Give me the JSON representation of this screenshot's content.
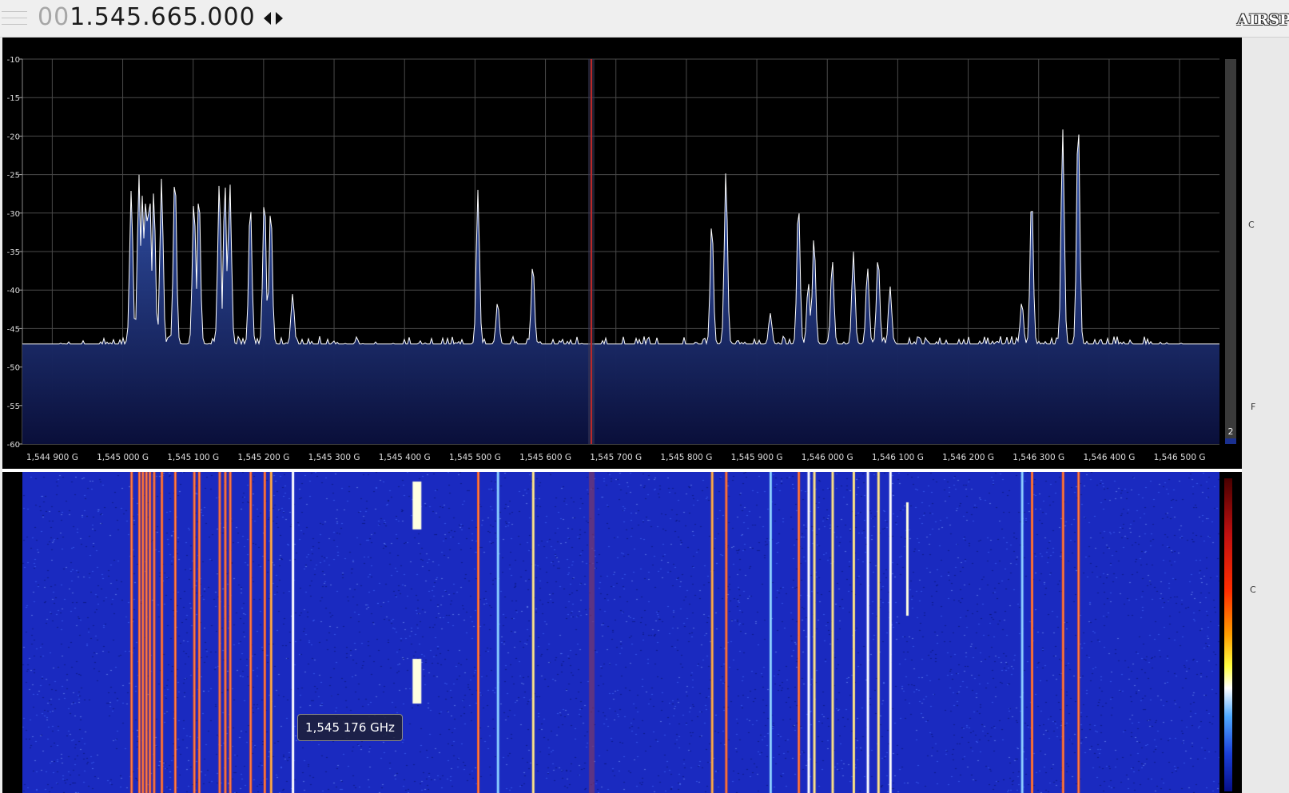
{
  "header": {
    "frequency_lead": "00",
    "frequency_main": "1.545.665.000",
    "logo": "AIRSPY"
  },
  "spectrum": {
    "db_labels": [
      "-10",
      "-15",
      "-20",
      "-25",
      "-30",
      "-35",
      "-40",
      "-45",
      "-50",
      "-55",
      "-60"
    ],
    "freq_labels": [
      "1,544 900 G",
      "1,545 000 G",
      "1,545 100 G",
      "1,545 200 G",
      "1,545 300 G",
      "1,545 400 G",
      "1,545 500 G",
      "1,545 600 G",
      "1,545 700 G",
      "1,545 800 G",
      "1,545 900 G",
      "1,546 000 G",
      "1,546 100 G",
      "1,546 200 G",
      "1,546 300 G",
      "1,546 400 G",
      "1,546 500 G"
    ],
    "level_indicator": "2",
    "noise_floor_db": -47,
    "peaks": [
      {
        "f": 1545.0121,
        "db": -27
      },
      {
        "f": 1545.0231,
        "db": -25
      },
      {
        "f": 1545.0281,
        "db": -27.5
      },
      {
        "f": 1545.0331,
        "db": -27.5
      },
      {
        "f": 1545.0381,
        "db": -27
      },
      {
        "f": 1545.0441,
        "db": -27
      },
      {
        "f": 1545.0551,
        "db": -25.5
      },
      {
        "f": 1545.0741,
        "db": -24.5
      },
      {
        "f": 1545.1011,
        "db": -28
      },
      {
        "f": 1545.1081,
        "db": -27
      },
      {
        "f": 1545.1371,
        "db": -26
      },
      {
        "f": 1545.1451,
        "db": -26
      },
      {
        "f": 1545.1521,
        "db": -26
      },
      {
        "f": 1545.1811,
        "db": -28.5
      },
      {
        "f": 1545.2011,
        "db": -27.5
      },
      {
        "f": 1545.2101,
        "db": -29
      },
      {
        "f": 1545.2411,
        "db": -40.5
      },
      {
        "f": 1545.5041,
        "db": -27
      },
      {
        "f": 1545.5321,
        "db": -41.5
      },
      {
        "f": 1545.5821,
        "db": -36.5
      },
      {
        "f": 1545.8361,
        "db": -31
      },
      {
        "f": 1545.8561,
        "db": -24.5
      },
      {
        "f": 1545.9191,
        "db": -43
      },
      {
        "f": 1545.9591,
        "db": -28.5
      },
      {
        "f": 1545.9731,
        "db": -39
      },
      {
        "f": 1545.9811,
        "db": -33
      },
      {
        "f": 1546.0071,
        "db": -36
      },
      {
        "f": 1546.0371,
        "db": -35
      },
      {
        "f": 1546.0571,
        "db": -37
      },
      {
        "f": 1546.0721,
        "db": -35.5
      },
      {
        "f": 1546.0891,
        "db": -39.5
      },
      {
        "f": 1546.2761,
        "db": -41.5
      },
      {
        "f": 1546.2901,
        "db": -27.5
      },
      {
        "f": 1546.3341,
        "db": -19
      },
      {
        "f": 1546.3561,
        "db": -17.5
      }
    ],
    "center_marker_f": 1545.6651
  },
  "waterfall": {
    "tooltip": "1,545 176 GHz"
  },
  "right_strip": {
    "label_a": "C",
    "label_b": "F",
    "label_c": "C"
  },
  "colors": {
    "trace": "#ffffff",
    "fill_top": "#3a5fc0",
    "fill_bottom": "#0a0f3a",
    "grid": "#4a4a4a",
    "center_marker": "#c02828",
    "waterfall_bg": "#1a2ac0"
  }
}
